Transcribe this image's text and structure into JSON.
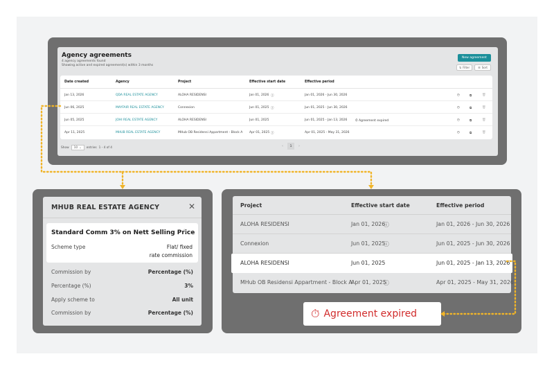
{
  "top": {
    "title": "Agency agreements",
    "found": "4 agency agreements found",
    "showing": "Showing active and expired agreement(s) within 3 months",
    "new_btn": "New agreement",
    "filter_btn": "Filter",
    "sort_btn": "Sort",
    "columns": [
      "Date created",
      "Agency",
      "Project",
      "Effective start date",
      "Effective period"
    ],
    "rows": [
      {
        "date": "Jan 13, 2026",
        "agency": "QDA REAL ESTATE AGENCY",
        "project": "ALOHA RESIDENSI",
        "start": "Jan 01, 2026",
        "period": "Jan 01, 2026 - Jun 30, 2026",
        "status": ""
      },
      {
        "date": "Jun 06, 2025",
        "agency": "MAYFAIR REAL ESTATE AGENCY",
        "project": "Connexion",
        "start": "Jun 01, 2025",
        "period": "Jun 01, 2025 - Jun 30, 2026",
        "status": ""
      },
      {
        "date": "Jun 05, 2025",
        "agency": "JOHI REAL ESTATE AGENCY",
        "project": "ALOHA RESIDENSI",
        "start": "Jun 01, 2025",
        "period": "Jun 01, 2025 - Jan 13, 2026",
        "status": "Agreement expired"
      },
      {
        "date": "Apr 11, 2025",
        "agency": "MHUB REAL ESTATE AGENCY",
        "project": "MHub OB Residensi Appartment - Block A",
        "start": "Apr 01, 2025",
        "period": "Apr 01, 2025 - May 31, 2026",
        "status": ""
      }
    ],
    "show_label": "Show",
    "show_value": "10",
    "entries_label": "entries",
    "range": "1 - 4 of 4",
    "page": "1"
  },
  "detail": {
    "agency": "MHUB REAL ESTATE AGENCY",
    "scheme_title": "Standard Comm 3% on Nett Selling Price",
    "scheme_type_label": "Scheme type",
    "scheme_type_value1": "Flat/ fixed",
    "scheme_type_value2": "rate commission",
    "fields": [
      {
        "k": "Commission by",
        "v": "Percentage (%)"
      },
      {
        "k": "Percentage (%)",
        "v": "3%"
      },
      {
        "k": "Apply scheme to",
        "v": "All unit"
      },
      {
        "k": "Commission by",
        "v": "Percentage (%)"
      }
    ]
  },
  "zoom": {
    "columns": [
      "Project",
      "Effective start date",
      "Effective period"
    ],
    "rows": [
      {
        "project": "ALOHA RESIDENSI",
        "start": "Jan 01, 2026",
        "period": "Jan 01, 2026 - Jun 30, 2026"
      },
      {
        "project": "Connexion",
        "start": "Jun 01, 2025",
        "period": "Jun 01, 2025 - Jun 30, 2026"
      },
      {
        "project": "ALOHA RESIDENSI",
        "start": "Jun 01, 2025",
        "period": "Jun 01, 2025 - Jan 13, 2026"
      },
      {
        "project": "MHub OB Residensi Appartment - Block A",
        "start": "Apr 01, 2025",
        "period": "Apr 01, 2025 - May 31, 2026"
      }
    ],
    "expired_label": "Agreement expired"
  },
  "colors": {
    "accent": "#1b8f9a",
    "expired": "#d12b2b",
    "connector": "#f0b429"
  }
}
